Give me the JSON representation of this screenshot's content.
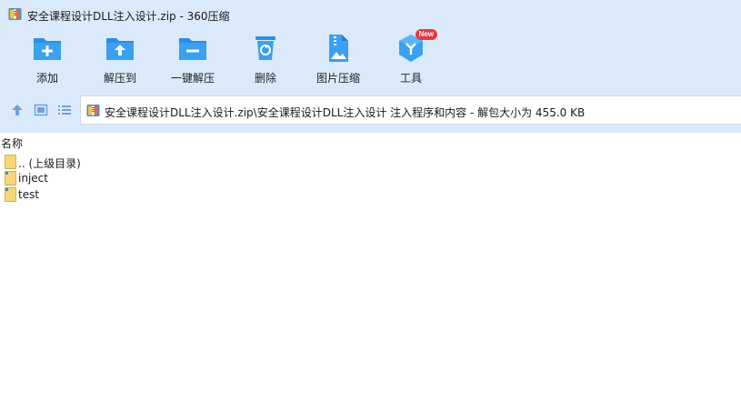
{
  "window": {
    "title": "安全课程设计DLL注入设计.zip - 360压缩"
  },
  "toolbar": {
    "items": [
      {
        "label": "添加",
        "icon": "add-folder-icon"
      },
      {
        "label": "解压到",
        "icon": "extract-folder-icon"
      },
      {
        "label": "一键解压",
        "icon": "one-click-extract-icon"
      },
      {
        "label": "删除",
        "icon": "trash-icon"
      },
      {
        "label": "图片压缩",
        "icon": "image-compress-icon"
      },
      {
        "label": "工具",
        "icon": "tools-cube-icon",
        "badge": "New"
      }
    ]
  },
  "address": {
    "path": "安全课程设计DLL注入设计.zip\\安全课程设计DLL注入设计 注入程序和内容 - 解包大小为 455.0 KB"
  },
  "list": {
    "column_name": "名称",
    "rows": [
      {
        "name": ".. (上级目录)",
        "type": "folder"
      },
      {
        "name": "inject",
        "type": "folder"
      },
      {
        "name": "test",
        "type": "folder"
      }
    ]
  },
  "colors": {
    "chrome_bg": "#dbeafa",
    "icon_blue": "#2a8ee6",
    "folder_yellow": "#f7d774",
    "badge_red": "#e8383d"
  }
}
